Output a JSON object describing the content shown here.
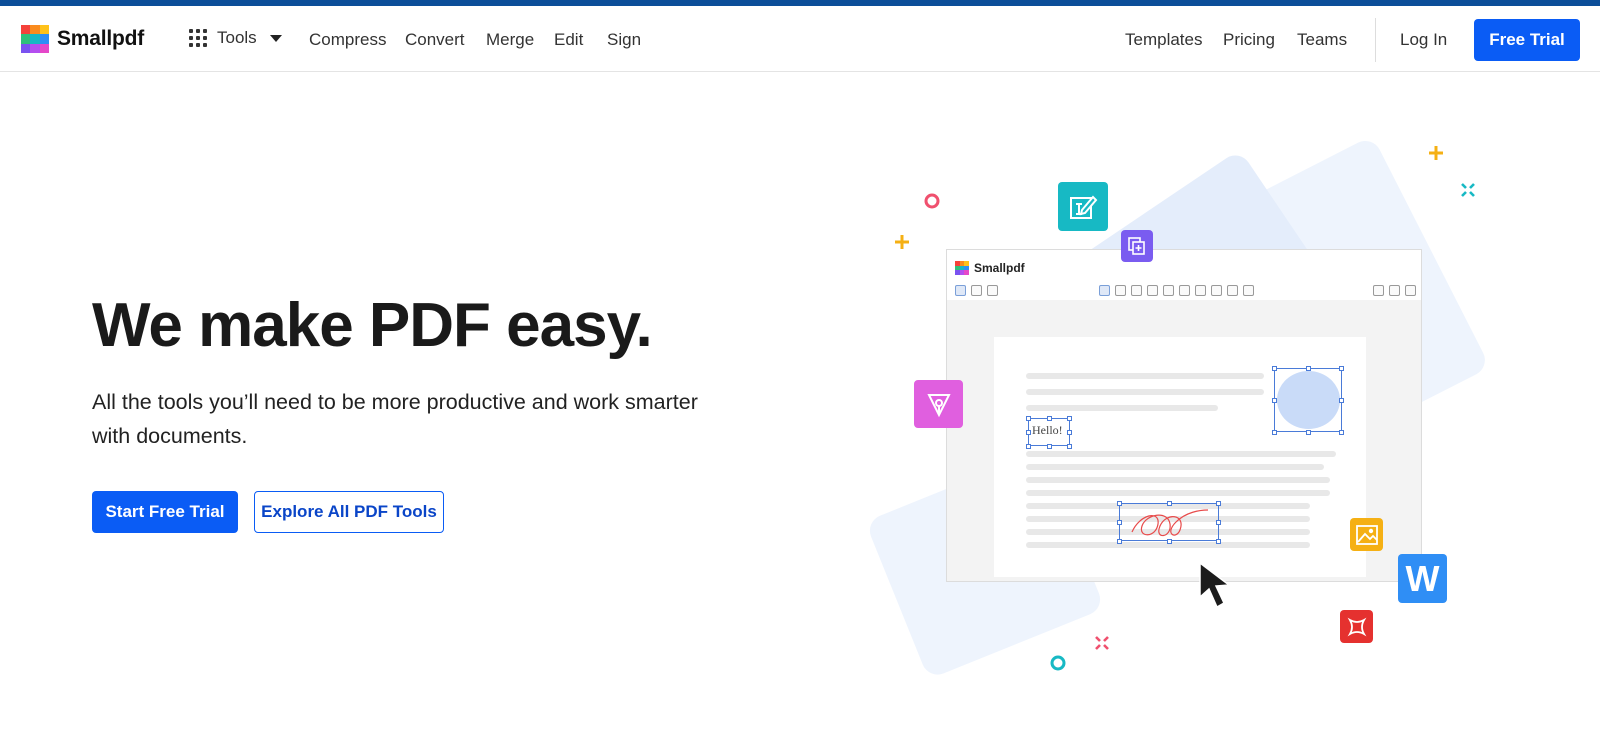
{
  "brand": {
    "name": "Smallpdf",
    "logo_colors": [
      "#f5423a",
      "#fa8b1e",
      "#ffc21a",
      "#2ec17a",
      "#16b8c4",
      "#2f8ef5",
      "#7a52f0",
      "#b44ef0",
      "#e548c9"
    ]
  },
  "nav": {
    "tools_label": "Tools",
    "links": [
      "Compress",
      "Convert",
      "Merge",
      "Edit",
      "Sign"
    ],
    "right_links": [
      "Templates",
      "Pricing",
      "Teams"
    ],
    "login": "Log In",
    "cta": "Free Trial"
  },
  "hero": {
    "title": "We make PDF easy.",
    "subtitle": "All the tools you’ll need to be more productive and work smarter with documents.",
    "primary_button": "Start Free Trial",
    "secondary_button": "Explore All PDF Tools"
  },
  "illustration": {
    "app_name": "Smallpdf",
    "sample_text": "Hello!",
    "floating_icons": [
      "edit-text-icon",
      "copy-add-icon",
      "pen-nib-icon",
      "image-icon",
      "word-icon",
      "acrobat-icon"
    ],
    "word_letter": "W"
  },
  "colors": {
    "accent": "#0a5cf5",
    "top_bar": "#0c4e99",
    "teal": "#17b9c4",
    "purple": "#7a5cf0",
    "magenta": "#e05fdf",
    "yellow": "#f5b014",
    "word_blue": "#2f8ef5",
    "red": "#e5312f"
  }
}
